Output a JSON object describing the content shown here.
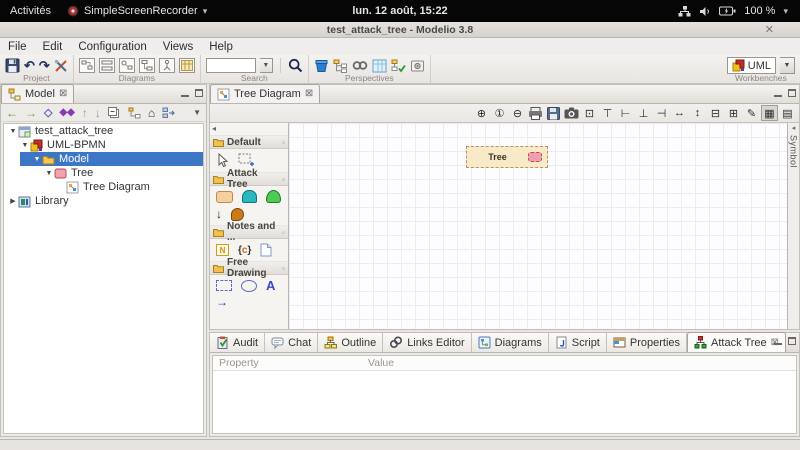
{
  "system_bar": {
    "activities": "Activités",
    "app_name": "SimpleScreenRecorder",
    "clock": "lun. 12 août, 15:22",
    "battery_percent": "100 %",
    "icons": [
      "recorder-icon",
      "network-icon",
      "volume-icon",
      "battery-icon"
    ]
  },
  "window": {
    "title": "test_attack_tree - Modelio 3.8"
  },
  "menu": {
    "items": [
      "File",
      "Edit",
      "Configuration",
      "Views",
      "Help"
    ]
  },
  "toolbar": {
    "group_labels": {
      "project": "Project",
      "diagrams": "Diagrams",
      "search": "Search",
      "perspectives": "Perspectives",
      "workbenches": "Workbenches"
    },
    "search_value": "",
    "workbench_selected": "UML",
    "project_icons": [
      "save-icon",
      "undo-icon",
      "redo-icon",
      "tools-icon"
    ],
    "diagram_icons": [
      "diagram-1-icon",
      "diagram-2-icon",
      "diagram-3-icon",
      "diagram-4-icon",
      "diagram-5-icon",
      "diagram-6-icon"
    ],
    "perspective_icons": [
      "perspective-bucket-icon",
      "perspective-hierarchy-icon",
      "perspective-link-icon",
      "perspective-table-icon",
      "perspective-checked-tree-icon",
      "perspective-box-icon"
    ]
  },
  "model_panel": {
    "tab_label": "Model",
    "toolbar_icons": [
      "back-icon",
      "forward-icon",
      "diamond-outline-icon",
      "diamond-solid-icon",
      "move-up-icon",
      "move-down-icon",
      "collapse-all-icon",
      "link-with-editor-icon",
      "home-icon",
      "flat-view-icon",
      "view-menu-icon"
    ],
    "tree": [
      {
        "label": "test_attack_tree",
        "level": 0,
        "state": "expanded",
        "icon": "project-icon",
        "selected": false
      },
      {
        "label": "UML-BPMN",
        "level": 1,
        "state": "expanded",
        "icon": "uml-module-icon",
        "selected": false
      },
      {
        "label": "Model",
        "level": 2,
        "state": "expanded",
        "icon": "folder-icon",
        "selected": true
      },
      {
        "label": "Tree",
        "level": 3,
        "state": "expanded",
        "icon": "attack-tree-icon",
        "selected": false
      },
      {
        "label": "Tree Diagram",
        "level": 4,
        "state": "leaf",
        "icon": "diagram-icon",
        "selected": false
      },
      {
        "label": "Library",
        "level": 0,
        "state": "collapsed",
        "icon": "library-icon",
        "selected": false
      }
    ]
  },
  "editor": {
    "tab_label": "Tree Diagram",
    "toolbar_icons": [
      "zoom-in",
      "zoom-actual",
      "zoom-out",
      "print",
      "save-diagram",
      "snapshot",
      "select-area",
      "align-top",
      "align-left",
      "align-bottom",
      "align-right",
      "same-width",
      "same-height",
      "collapse",
      "expand",
      "format-painter",
      "grid-toggle",
      "page-layout"
    ],
    "grid_toggle_pressed": true,
    "palette": {
      "sections": [
        {
          "title": "Default",
          "tools": [
            "select-cursor",
            "marquee-zoom"
          ]
        },
        {
          "title": "Attack Tree",
          "tools": [
            "tree-node",
            "and-node",
            "or-node",
            "link-arrow",
            "operator-node"
          ]
        },
        {
          "title": "Notes and ...",
          "tools": [
            "note",
            "constraint",
            "document"
          ]
        },
        {
          "title": "Free Drawing",
          "tools": [
            "rectangle",
            "ellipse",
            "text",
            "line"
          ]
        }
      ]
    },
    "canvas": {
      "node_label": "Tree",
      "node_fill": "#f8e9c8",
      "node_border": "#bd9457",
      "node_icon_fill": "#ef9fae",
      "node_icon_border": "#b04a56",
      "grid_color": "#ecebf4"
    },
    "symbol_label": "Symbol"
  },
  "bottom_panel": {
    "tabs": [
      {
        "label": "Audit",
        "icon": "audit-icon"
      },
      {
        "label": "Chat",
        "icon": "chat-icon"
      },
      {
        "label": "Outline",
        "icon": "outline-icon"
      },
      {
        "label": "Links Editor",
        "icon": "links-icon"
      },
      {
        "label": "Diagrams",
        "icon": "diagrams-icon"
      },
      {
        "label": "Script",
        "icon": "script-icon"
      },
      {
        "label": "Properties",
        "icon": "properties-icon"
      },
      {
        "label": "Attack Tree",
        "icon": "attack-tree-icon",
        "active": true
      }
    ],
    "columns": [
      "Property",
      "Value"
    ]
  },
  "colors": {
    "selection": "#3d76c4",
    "topbar_bg": "#060606",
    "canvas_bg": "#fdfdff"
  }
}
